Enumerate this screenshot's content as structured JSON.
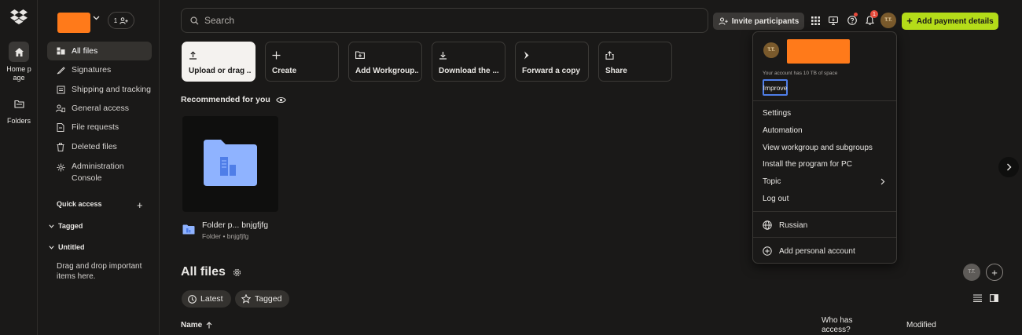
{
  "rail": {
    "items": [
      {
        "label": "Home p\nage",
        "icon": "home-icon"
      },
      {
        "label": "Folders",
        "icon": "folder-icon"
      }
    ]
  },
  "sidebar": {
    "team_count": "1",
    "nav": [
      {
        "label": "All files",
        "icon": "all-files-icon",
        "active": true
      },
      {
        "label": "Signatures",
        "icon": "signature-icon"
      },
      {
        "label": "Shipping and tracking",
        "icon": "shipping-icon"
      },
      {
        "label": "General access",
        "icon": "shared-icon"
      },
      {
        "label": "File requests",
        "icon": "file-request-icon"
      },
      {
        "label": "Deleted files",
        "icon": "trash-icon"
      },
      {
        "label": "Administration Console",
        "icon": "admin-icon"
      }
    ],
    "quick_access": "Quick access",
    "tagged": "Tagged",
    "untitled": "Untitled",
    "drag_note": "Drag and drop important items here."
  },
  "search": {
    "placeholder": "Search"
  },
  "topbar": {
    "invite_label": "Invite participants",
    "notification_count": "1",
    "avatar_initials": "T.T.",
    "pay_label": "Add payment details"
  },
  "actions": [
    {
      "label": "Upload or drag ...",
      "icon": "upload-icon"
    },
    {
      "label": "Create",
      "icon": "plus-icon"
    },
    {
      "label": "Add Workgroup...",
      "icon": "folder-plus-icon"
    },
    {
      "label": "Download the ...",
      "icon": "download-icon"
    },
    {
      "label": "Forward a copy",
      "icon": "transfer-icon"
    },
    {
      "label": "Share",
      "icon": "share-icon"
    }
  ],
  "recommended": {
    "title": "Recommended for you",
    "item_name": "Folder p... bnjgfjfg",
    "item_meta": "Folder • bnjgfjfg"
  },
  "all_files": {
    "title": "All files",
    "chips": [
      "Latest",
      "Tagged"
    ],
    "columns": {
      "name": "Name",
      "access": "Who has access?",
      "modified": "Modified"
    },
    "owner_initials": "T.T."
  },
  "account_menu": {
    "avatar_initials": "T.T.",
    "space_text": "Your account has 10 TB of space",
    "improve": "Improve",
    "items": [
      "Settings",
      "Automation",
      "View workgroup and subgroups",
      "Install the program for PC",
      "Topic",
      "Log out"
    ],
    "language": "Russian",
    "add_account": "Add personal account"
  },
  "colors": {
    "accent_green": "#b4dc19",
    "redaction_orange": "#ff7a1a",
    "focus_blue": "#4f7ee8"
  }
}
